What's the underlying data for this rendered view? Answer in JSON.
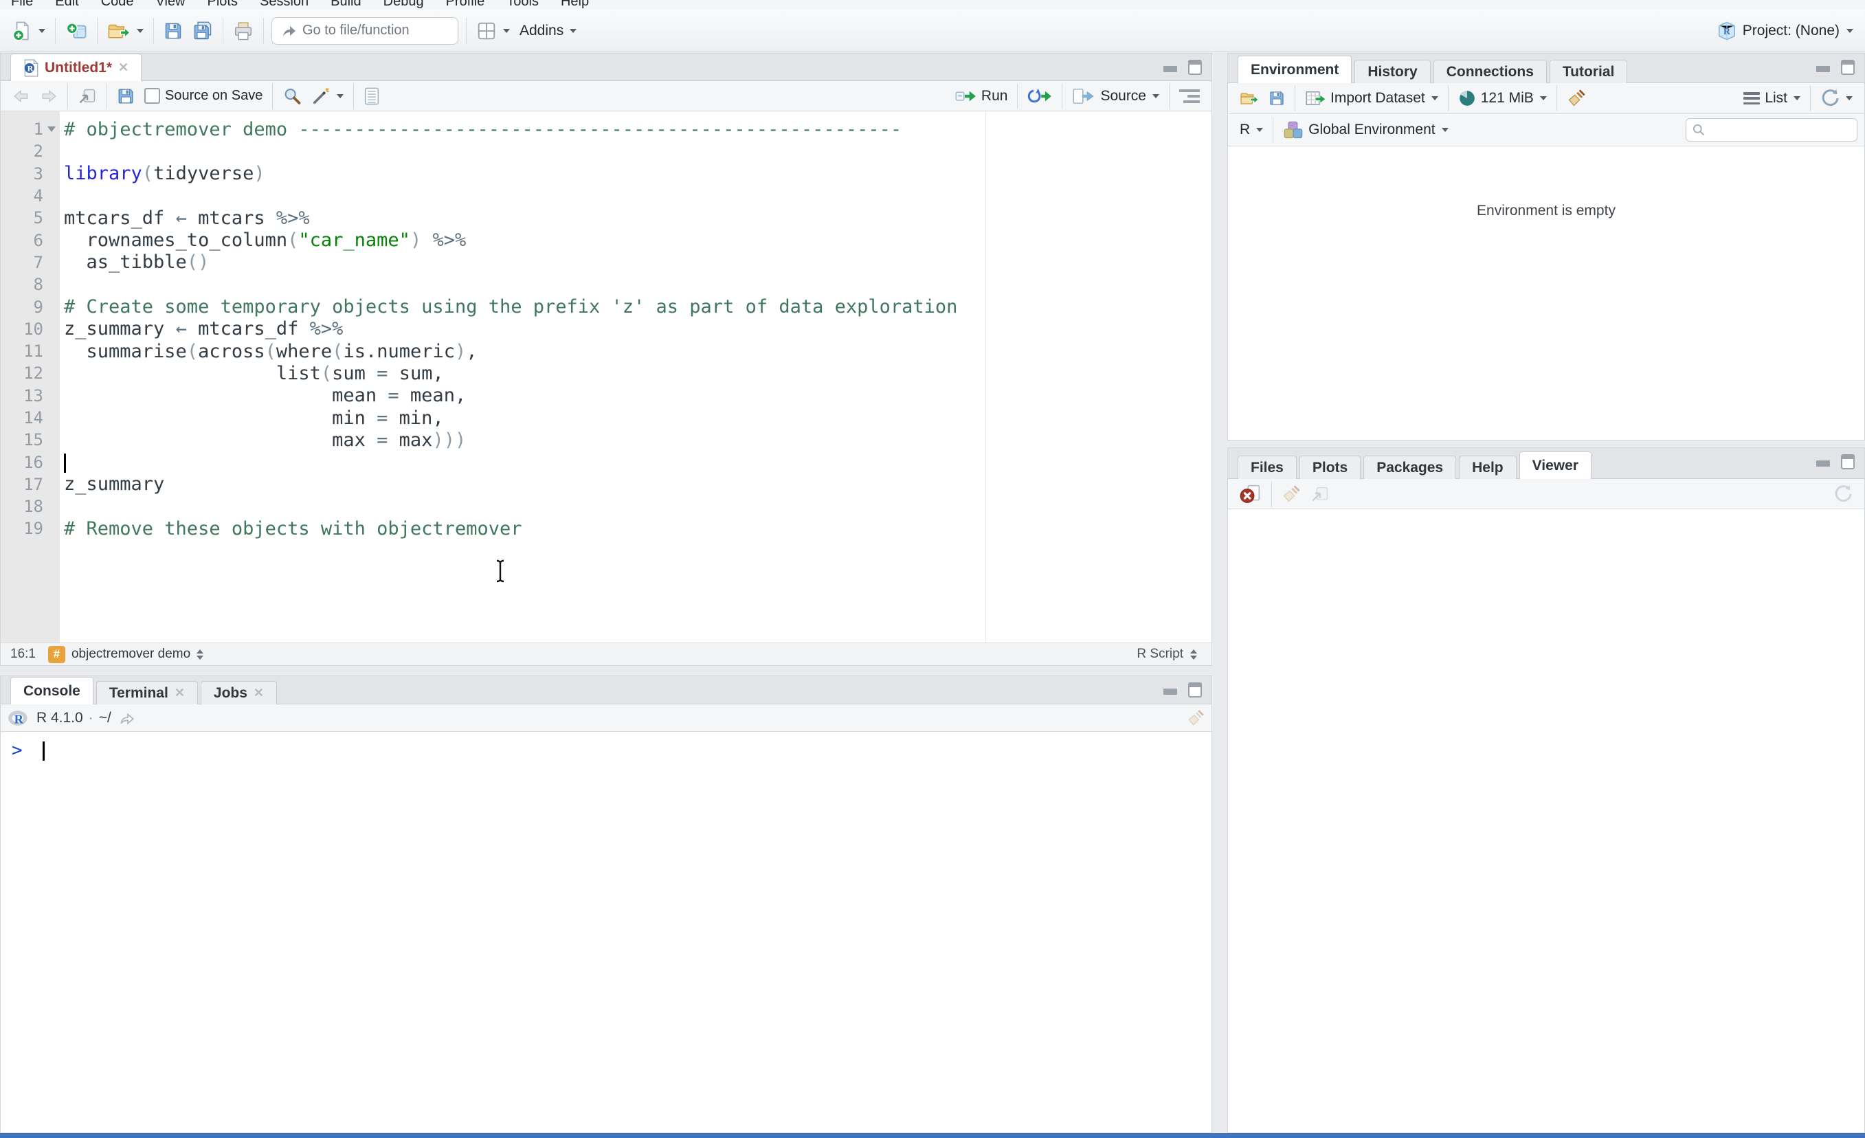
{
  "menu": {
    "items": [
      "File",
      "Edit",
      "Code",
      "View",
      "Plots",
      "Session",
      "Build",
      "Debug",
      "Profile",
      "Tools",
      "Help"
    ]
  },
  "toolbar": {
    "goto_placeholder": "Go to file/function",
    "addins_label": "Addins",
    "project_label": "Project: (None)"
  },
  "source_pane": {
    "tab_title": "Untitled1*",
    "toolbar": {
      "source_on_save": "Source on Save",
      "run_label": "Run",
      "source_label": "Source"
    },
    "status": {
      "cursor_position": "16:1",
      "section_symbol": "#",
      "section_name": "objectremover demo",
      "file_type": "R Script"
    },
    "code": {
      "lines": [
        {
          "n": 1,
          "fold": true,
          "tokens": [
            [
              "com",
              "# objectremover demo ------------------------------------------------------"
            ]
          ]
        },
        {
          "n": 2,
          "tokens": []
        },
        {
          "n": 3,
          "tokens": [
            [
              "fn",
              "library"
            ],
            [
              "par",
              "("
            ],
            [
              "txt",
              "tidyverse"
            ],
            [
              "par",
              ")"
            ]
          ]
        },
        {
          "n": 4,
          "tokens": []
        },
        {
          "n": 5,
          "tokens": [
            [
              "txt",
              "mtcars_df "
            ],
            [
              "op",
              "← "
            ],
            [
              "txt",
              "mtcars "
            ],
            [
              "op",
              "%>%"
            ]
          ]
        },
        {
          "n": 6,
          "tokens": [
            [
              "txt",
              "  rownames_to_column"
            ],
            [
              "par",
              "("
            ],
            [
              "str",
              "\"car_name\""
            ],
            [
              "par",
              ")"
            ],
            [
              "txt",
              " "
            ],
            [
              "op",
              "%>%"
            ]
          ]
        },
        {
          "n": 7,
          "tokens": [
            [
              "txt",
              "  as_tibble"
            ],
            [
              "par",
              "()"
            ]
          ]
        },
        {
          "n": 8,
          "tokens": []
        },
        {
          "n": 9,
          "tokens": [
            [
              "com",
              "# Create some temporary objects using the prefix 'z' as part of data exploration"
            ]
          ]
        },
        {
          "n": 10,
          "tokens": [
            [
              "txt",
              "z_summary "
            ],
            [
              "op",
              "← "
            ],
            [
              "txt",
              "mtcars_df "
            ],
            [
              "op",
              "%>%"
            ]
          ]
        },
        {
          "n": 11,
          "tokens": [
            [
              "txt",
              "  summarise"
            ],
            [
              "par",
              "("
            ],
            [
              "txt",
              "across"
            ],
            [
              "par",
              "("
            ],
            [
              "txt",
              "where"
            ],
            [
              "par",
              "("
            ],
            [
              "txt",
              "is.numeric"
            ],
            [
              "par",
              ")"
            ],
            [
              "txt",
              ","
            ]
          ]
        },
        {
          "n": 12,
          "tokens": [
            [
              "txt",
              "                   list"
            ],
            [
              "par",
              "("
            ],
            [
              "txt",
              "sum "
            ],
            [
              "op",
              "= "
            ],
            [
              "txt",
              "sum,"
            ]
          ]
        },
        {
          "n": 13,
          "tokens": [
            [
              "txt",
              "                        mean "
            ],
            [
              "op",
              "= "
            ],
            [
              "txt",
              "mean,"
            ]
          ]
        },
        {
          "n": 14,
          "tokens": [
            [
              "txt",
              "                        min "
            ],
            [
              "op",
              "= "
            ],
            [
              "txt",
              "min,"
            ]
          ]
        },
        {
          "n": 15,
          "tokens": [
            [
              "txt",
              "                        max "
            ],
            [
              "op",
              "= "
            ],
            [
              "txt",
              "max"
            ],
            [
              "par",
              ")))"
            ]
          ]
        },
        {
          "n": 16,
          "caret": true,
          "tokens": []
        },
        {
          "n": 17,
          "tokens": [
            [
              "txt",
              "z_summary"
            ]
          ]
        },
        {
          "n": 18,
          "tokens": []
        },
        {
          "n": 19,
          "tokens": [
            [
              "com",
              "# Remove these objects with objectremover"
            ]
          ]
        }
      ]
    }
  },
  "console_pane": {
    "tabs": [
      {
        "label": "Console",
        "active": true,
        "closable": false
      },
      {
        "label": "Terminal",
        "active": false,
        "closable": true
      },
      {
        "label": "Jobs",
        "active": false,
        "closable": true
      }
    ],
    "info": {
      "version": "R 4.1.0",
      "separator": "·",
      "path": "~/"
    },
    "prompt": ">"
  },
  "environment_pane": {
    "tabs": [
      {
        "label": "Environment",
        "active": true
      },
      {
        "label": "History",
        "active": false
      },
      {
        "label": "Connections",
        "active": false
      },
      {
        "label": "Tutorial",
        "active": false
      }
    ],
    "toolbar": {
      "import_label": "Import Dataset",
      "memory_label": "121 MiB",
      "list_label": "List"
    },
    "scope_row": {
      "language": "R",
      "scope": "Global Environment"
    },
    "empty_message": "Environment is empty"
  },
  "viewer_pane": {
    "tabs": [
      {
        "label": "Files",
        "active": false
      },
      {
        "label": "Plots",
        "active": false
      },
      {
        "label": "Packages",
        "active": false
      },
      {
        "label": "Help",
        "active": false
      },
      {
        "label": "Viewer",
        "active": true
      }
    ]
  }
}
